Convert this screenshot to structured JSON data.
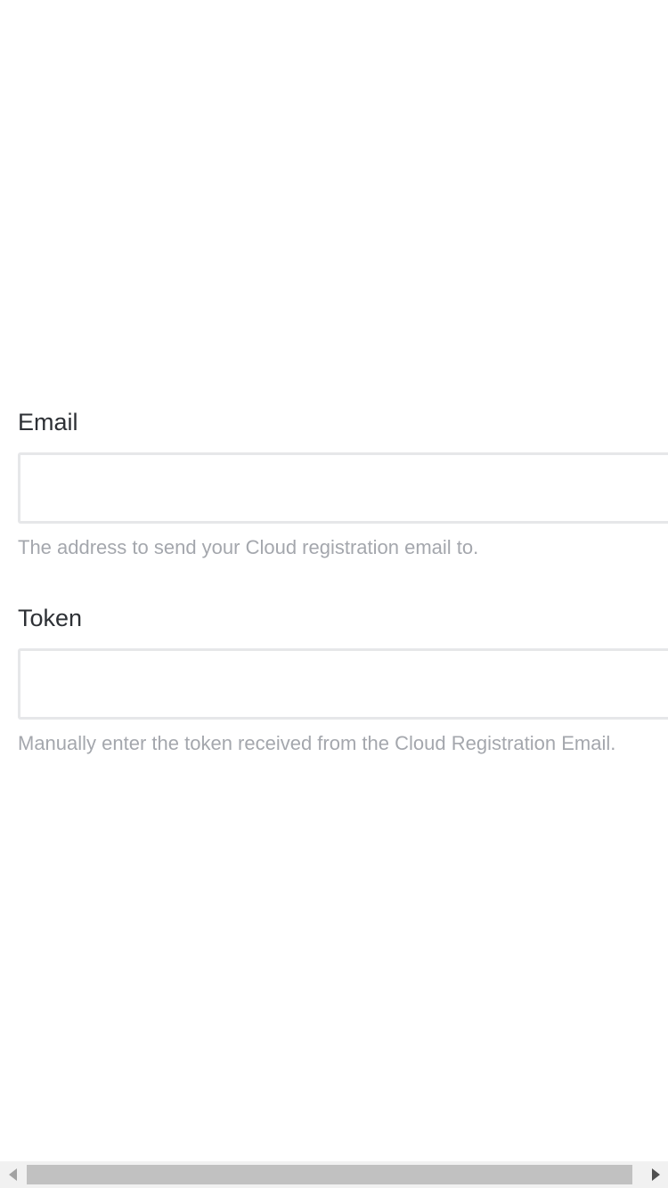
{
  "form": {
    "email": {
      "label": "Email",
      "value": "",
      "help": "The address to send your Cloud registration email to."
    },
    "token": {
      "label": "Token",
      "value": "",
      "help": "Manually enter the token received from the Cloud Registration Email."
    }
  },
  "scrollbar": {
    "left_icon": "arrow-left-icon",
    "right_icon": "arrow-right-icon"
  }
}
